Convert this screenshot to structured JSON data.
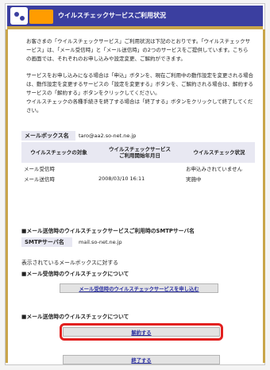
{
  "header": {
    "title": "ウイルスチェックサービスご利用状況"
  },
  "intro": {
    "para1": "お客さまの「ウイルスチェックサービス」ご利用状況は下記のとおりです。「ウイルスチェックサービス」は、「メール受信時」と「メール送信時」の2つのサービスをご提供しています。こちらの画面では、それぞれのお申し込みや設定変更、ご解約ができます。",
    "para2": "サービスをお申し込みになる場合は「申込」ボタンを、現在ご利用中の動作設定を変更される場合は、動作設定を変更するサービスの「設定を変更する」ボタンを、ご解約される場合は、解約するサービスの「解約する」ボタンをクリックしてください。",
    "para3": "ウイルスチェックの各種手続きを終了する場合は「終了する」ボタンをクリックして終了してください。"
  },
  "mailbox": {
    "label": "メールボックス名",
    "value": "taro@aa2.so-net.ne.jp"
  },
  "table": {
    "headers": [
      "ウイルスチェックの対象",
      "ウイルスチェックサービス\nご利用開始年月日",
      "ウイルスチェック状況"
    ],
    "rows": [
      {
        "target": "メール受信時",
        "start": "",
        "status": "お申込みされていません"
      },
      {
        "target": "メール送信時",
        "start": "2008/03/10 16:11",
        "status": "実施中"
      }
    ]
  },
  "smtp": {
    "section_title": "■メール送信時のウイルスチェックサービスご利用時のSMTPサーバ名",
    "label": "SMTPサーバ名",
    "value": "mail.so-net.ne.jp"
  },
  "actions": {
    "lead_text": "表示されているメールボックスに対する",
    "receive_heading": "■メール受信時のウイルスチェックについて",
    "receive_button": "メール受信時のウイルスチェックサービスを申し込む",
    "send_heading": "■メール送信時のウイルスチェックについて",
    "cancel_button": "解約する",
    "finish_button": "終了する"
  },
  "colors": {
    "header_bg": "#3b3fa0",
    "accent_gold": "#c9a54a",
    "logo_orange": "#ff9c00",
    "highlight_red": "#e2201f",
    "link_blue": "#2a2fa0"
  }
}
